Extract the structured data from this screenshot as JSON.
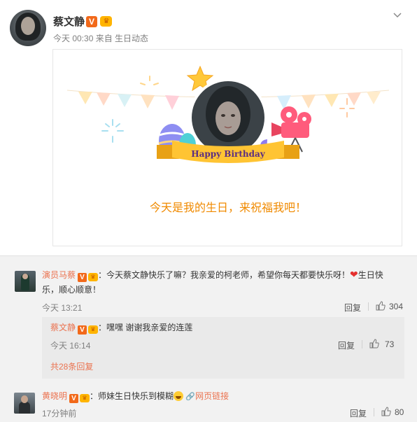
{
  "post": {
    "author": "蔡文静",
    "verified_badge": "V",
    "member_badge": "♛",
    "meta": "今天 00:30 来自 生日动态",
    "card": {
      "banner_text": "Happy Birthday",
      "wish_text": "今天是我的生日，来祝福我吧！"
    }
  },
  "comments": [
    {
      "author": "演员马蔡",
      "line1": "：今天蔡文静快乐了嘛？我亲爱的柯老师，希望你每天都要快乐呀！",
      "line1_tail": "生日快",
      "line2": "乐，顺心顺意！",
      "time": "今天 13:21",
      "reply_label": "回复",
      "likes": "304",
      "sub_reply": {
        "author": "蔡文静",
        "text": "：嘿嘿 谢谢我亲爱的连莲",
        "time": "今天 16:14",
        "reply_label": "回复",
        "likes": "73"
      },
      "more_replies": "共28条回复"
    },
    {
      "author": "黄晓明",
      "text": "：师妹生日快乐到模糊",
      "link_text": "网页链接",
      "time": "17分钟前",
      "reply_label": "回复",
      "likes": "80"
    }
  ],
  "colors": {
    "accent": "#eb7350",
    "wish": "#f08a00",
    "badge": "#f2691a"
  }
}
